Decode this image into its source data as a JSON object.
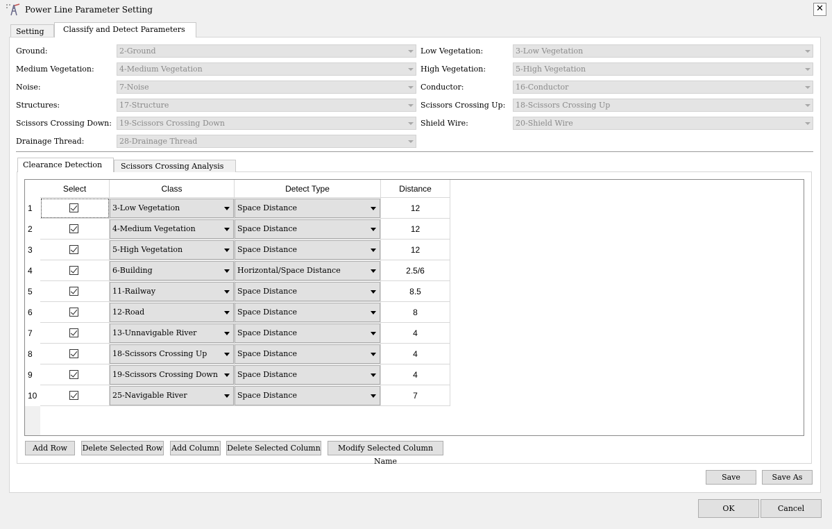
{
  "window": {
    "title": "Power Line Parameter Setting",
    "close_label": "✕"
  },
  "tabs": [
    "Setting",
    "Classify and Detect Parameters"
  ],
  "params": [
    {
      "label": "Ground:",
      "value": "2-Ground"
    },
    {
      "label": "Low Vegetation:",
      "value": "3-Low Vegetation"
    },
    {
      "label": "Medium Vegetation:",
      "value": "4-Medium Vegetation"
    },
    {
      "label": "High Vegetation:",
      "value": "5-High Vegetation"
    },
    {
      "label": "Noise:",
      "value": "7-Noise"
    },
    {
      "label": "Conductor:",
      "value": "16-Conductor"
    },
    {
      "label": "Structures:",
      "value": "17-Structure"
    },
    {
      "label": "Scissors Crossing Up:",
      "value": "18-Scissors Crossing Up"
    },
    {
      "label": "Scissors Crossing Down:",
      "value": "19-Scissors Crossing Down"
    },
    {
      "label": "Shield Wire:",
      "value": "20-Shield Wire"
    },
    {
      "label": "Drainage Thread:",
      "value": "28-Drainage Thread"
    }
  ],
  "inner_tabs": [
    "Clearance Detection",
    "Scissors Crossing Analysis"
  ],
  "table": {
    "headers": [
      "Select",
      "Class",
      "Detect Type",
      "Distance"
    ],
    "rows": [
      {
        "num": "1",
        "checked": true,
        "class": "3-Low Vegetation",
        "detect": "Space Distance",
        "distance": "12"
      },
      {
        "num": "2",
        "checked": true,
        "class": "4-Medium Vegetation",
        "detect": "Space Distance",
        "distance": "12"
      },
      {
        "num": "3",
        "checked": true,
        "class": "5-High Vegetation",
        "detect": "Space Distance",
        "distance": "12"
      },
      {
        "num": "4",
        "checked": true,
        "class": "6-Building",
        "detect": "Horizontal/Space Distance",
        "distance": "2.5/6"
      },
      {
        "num": "5",
        "checked": true,
        "class": "11-Railway",
        "detect": "Space Distance",
        "distance": "8.5"
      },
      {
        "num": "6",
        "checked": true,
        "class": "12-Road",
        "detect": "Space Distance",
        "distance": "8"
      },
      {
        "num": "7",
        "checked": true,
        "class": "13-Unnavigable River",
        "detect": "Space Distance",
        "distance": "4"
      },
      {
        "num": "8",
        "checked": true,
        "class": "18-Scissors Crossing Up",
        "detect": "Space Distance",
        "distance": "4"
      },
      {
        "num": "9",
        "checked": true,
        "class": "19-Scissors Crossing Down",
        "detect": "Space Distance",
        "distance": "4"
      },
      {
        "num": "10",
        "checked": true,
        "class": "25-Navigable River",
        "detect": "Space Distance",
        "distance": "7"
      }
    ]
  },
  "table_buttons": [
    "Add Row",
    "Delete Selected Row",
    "Add Column",
    "Delete Selected Column",
    "Modify Selected Column Name"
  ],
  "footer": {
    "save": "Save",
    "save_as": "Save As",
    "ok": "OK",
    "cancel": "Cancel"
  }
}
